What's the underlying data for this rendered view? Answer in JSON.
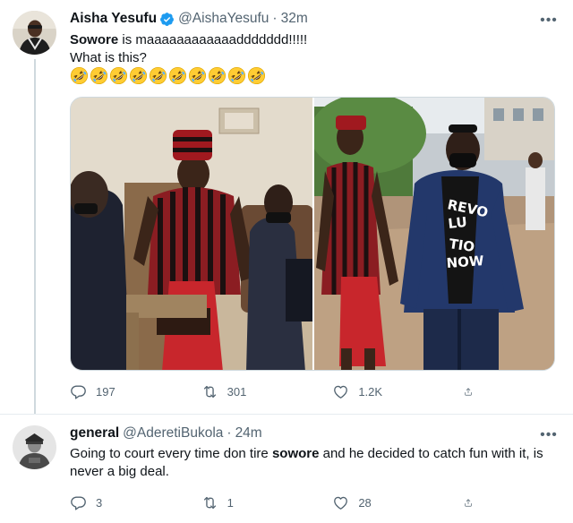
{
  "tweets": [
    {
      "author_name": "Aisha Yesufu",
      "handle": "@AishaYesufu",
      "separator": "·",
      "time": "32m",
      "verified": true,
      "text_bold": "Sowore",
      "text_rest": " is maaaaaaaaaaaaddddddd!!!!!",
      "text_line2": "What is this?",
      "emoji_name": "rolling-on-the-floor-laughing",
      "emoji_count": 10,
      "stats": {
        "replies": "197",
        "retweets": "301",
        "likes": "1.2K"
      },
      "media": [
        "photo-left",
        "photo-right"
      ],
      "photo_right_shirt_text": [
        "REVO",
        "LU",
        "TIO",
        "NOW"
      ]
    },
    {
      "author_name": "general",
      "handle": "@AderetiBukola",
      "separator": "·",
      "time": "24m",
      "verified": false,
      "text_before_bold": "Going to court every time don tire ",
      "text_bold": "sowore",
      "text_after_bold": " and he decided to catch fun with it, is never a big deal.",
      "stats": {
        "replies": "3",
        "retweets": "1",
        "likes": "28"
      }
    }
  ],
  "icons": {
    "more": "more-horizontal-icon",
    "reply": "reply-icon",
    "retweet": "retweet-icon",
    "like": "heart-icon",
    "share": "share-icon",
    "verified": "verified-badge-icon"
  },
  "colors": {
    "text_primary": "#0f1419",
    "text_secondary": "#536471",
    "verified_blue": "#1d9bf0",
    "border": "#cfd9de",
    "divider": "#e6ecf0"
  }
}
